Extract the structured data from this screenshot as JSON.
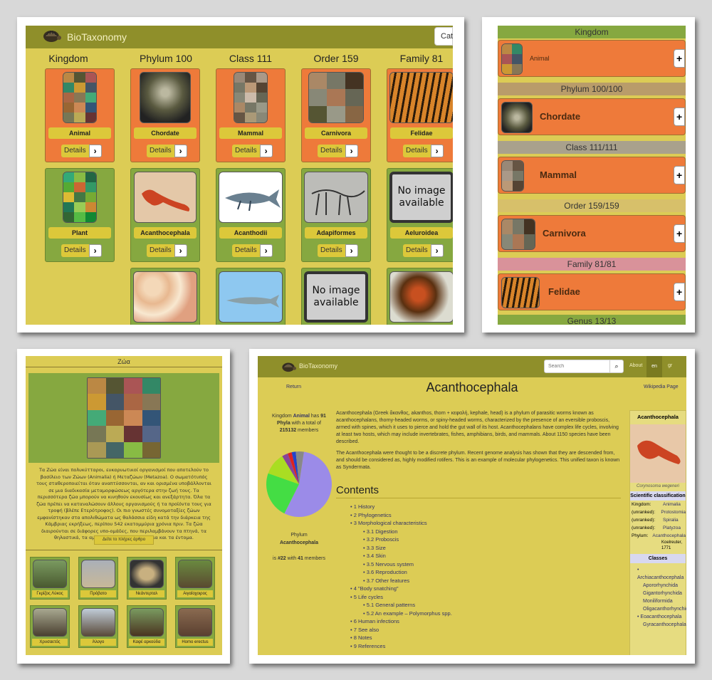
{
  "app": {
    "name": "BioTaxonomy"
  },
  "panel1": {
    "nav_btn": "Cat",
    "columns": [
      "Kingdom",
      "Phylum 100",
      "Class 111",
      "Order 159",
      "Family 81"
    ],
    "row1": [
      "Animal",
      "Chordate",
      "Mammal",
      "Carnivora",
      "Felidae"
    ],
    "row2": [
      "Plant",
      "Acanthocephala",
      "Acanthodii",
      "Adapiformes",
      "Aeluroidea"
    ],
    "details_label": "Details",
    "no_image": "No image available"
  },
  "panel2": {
    "levels": [
      "Kingdom",
      "Phylum 100/100",
      "Class 111/111",
      "Order 159/159",
      "Family 81/81",
      "Genus 13/13"
    ],
    "rows": [
      "Animal",
      "Chordate",
      "Mammal",
      "Carnivora",
      "Felidae"
    ]
  },
  "panel3": {
    "title": "Ζώα",
    "description": "Τα Ζώα είναι πολυκύτταροι, ευκαρυωτικοί οργανισμοί που αποτελούν το βασίλειο των Ζώων (Animalia) ή Μεταζώων (Metazoa). Ο σωματότυπός τους σταθεροποιείται όταν αναπτύσσονται, αν και ορισμένα υποβάλλονται σε μια διαδικασία μεταμορφώσεως αργότερα στην ζωή τους. Τα περισσότερα ζώα μπορούν να κινηθούν εκουσίως και ανεξάρτητα. Όλα τα ζώα πρέπει να καταναλώσουν άλλους οργανισμούς ή τα προϊόντα τους για τροφή (βλέπε Ετερότροφος). Οι πιο γνωστές συνομοταξίες ζώων εμφανίστηκαν στα απολιθώματα ως θαλάσσια είδη κατά την διάρκεια της Κάμβριας εκρήξεως, περίπου 542 εκατομμύρια χρόνια πριν. Τα ζώα διαιρούνται σε διάφορες υπο-ομάδες, που περιλαμβάνουν τα πτηνά, τα θηλαστικά, τα αμφίβια, τα ερπετά, τα ψάρια και τα έντομα.",
    "full_article_btn": "Δείτε το πλήρες άρθρο",
    "tiles": [
      "Γκρίζος Λύκος",
      "Πρόβατο",
      "Νεάντερταλ",
      "Αιγαίοχοιρος",
      "Χρυσαετός",
      "Άλογο",
      "Καφέ αρκούδα",
      "Homo erectus"
    ]
  },
  "panel4": {
    "search_placeholder": "Search",
    "nav_links": [
      "About",
      "en",
      "gr"
    ],
    "return_link": "Return",
    "page_title": "Acanthocephala",
    "wikipedia_link": "Wikipedia Page",
    "stats_top": [
      "Kingdom ",
      "Animal",
      " has ",
      "91",
      " Phyla",
      " with a total of ",
      "215132",
      " members"
    ],
    "stats_bottom": [
      "Phylum",
      "Acanthocephala",
      "is ",
      "#22",
      " with ",
      "41",
      " members"
    ],
    "pie": {
      "slices": [
        {
          "value": 55,
          "color": "#9b8be8"
        },
        {
          "value": 23,
          "color": "#44dd44"
        },
        {
          "value": 11,
          "color": "#aadd22"
        },
        {
          "value": 3,
          "color": "#884499"
        },
        {
          "value": 2,
          "color": "#dd2222"
        },
        {
          "value": 2,
          "color": "#2244cc"
        },
        {
          "value": 4,
          "color": "#888888"
        }
      ]
    },
    "para1": "Acanthocephala (Greek ἄκανθος, akanthos, thorn + κεφαλή, kephale, head) is a phylum of parasitic worms known as acanthocephalans, thorny-headed worms, or spiny-headed worms, characterized by the presence of an eversible proboscis, armed with spines, which it uses to pierce and hold the gut wall of its host. Acanthocephalans have complex life cycles, involving at least two hosts, which may include invertebrates, fishes, amphibians, birds, and mammals. About 1150 species have been described.",
    "para2": "The Acanthocephala were thought to be a discrete phylum. Recent genome analysis has shown that they are descended from, and should be considered as, highly modified rotifers. This is an example of molecular phylogenetics. This unified taxon is known as Syndermata.",
    "contents_title": "Contents",
    "contents": [
      {
        "t": "1 History",
        "sub": false
      },
      {
        "t": "2 Phylogenetics",
        "sub": false
      },
      {
        "t": "3 Morphological characteristics",
        "sub": false
      },
      {
        "t": "3.1 Digestion",
        "sub": true
      },
      {
        "t": "3.2 Proboscis",
        "sub": true
      },
      {
        "t": "3.3 Size",
        "sub": true
      },
      {
        "t": "3.4 Skin",
        "sub": true
      },
      {
        "t": "3.5 Nervous system",
        "sub": true
      },
      {
        "t": "3.6 Reproduction",
        "sub": true
      },
      {
        "t": "3.7 Other features",
        "sub": true
      },
      {
        "t": "4 \"Body snatching\"",
        "sub": false
      },
      {
        "t": "5 Life cycles",
        "sub": false
      },
      {
        "t": "5.1 General patterns",
        "sub": true
      },
      {
        "t": "5.2 An example – Polymorphus spp.",
        "sub": true
      },
      {
        "t": "6 Human infections",
        "sub": false
      },
      {
        "t": "7 See also",
        "sub": false
      },
      {
        "t": "8 Notes",
        "sub": false
      },
      {
        "t": "9 References",
        "sub": false
      }
    ],
    "infobox": {
      "title": "Acanthocephala",
      "caption": "Corynosoma wegeneri",
      "sci_heading": "Scientific classification",
      "rows": [
        [
          "Kingdom:",
          "Animalia"
        ],
        [
          "(unranked):",
          "Protostomia"
        ],
        [
          "(unranked):",
          "Spiralia"
        ],
        [
          "(unranked):",
          "Platyzoa"
        ],
        [
          "Phylum:",
          "Acanthocephala"
        ]
      ],
      "authority": "Koelreuter, 1771",
      "classes_heading": "Classes",
      "classes": [
        "Archiacanthocephala",
        "Apororhynchida",
        "Gigantorhynchida",
        "Moniliformida",
        "Oligacanthorhynchida",
        "Eoacanthocephala",
        "Gyracanthocephala"
      ]
    }
  }
}
